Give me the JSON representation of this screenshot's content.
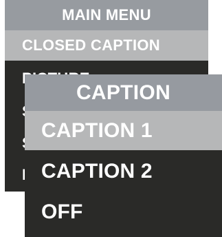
{
  "main_menu": {
    "title": "MAIN MENU",
    "items": [
      {
        "label": "CLOSED CAPTION",
        "selected": true
      },
      {
        "label": "PICTURE",
        "selected": false
      },
      {
        "label": "S",
        "selected": false
      },
      {
        "label": "S",
        "selected": false
      },
      {
        "label": "F",
        "selected": false
      }
    ]
  },
  "caption_menu": {
    "title": "CAPTION",
    "items": [
      {
        "label": "CAPTION 1",
        "selected": true
      },
      {
        "label": "CAPTION 2",
        "selected": false
      },
      {
        "label": "OFF",
        "selected": false
      }
    ]
  },
  "colors": {
    "panel_background": "#2a2a28",
    "header_background": "#979ba0",
    "selected_background": "#b6b7b8",
    "text": "#ffffff"
  }
}
